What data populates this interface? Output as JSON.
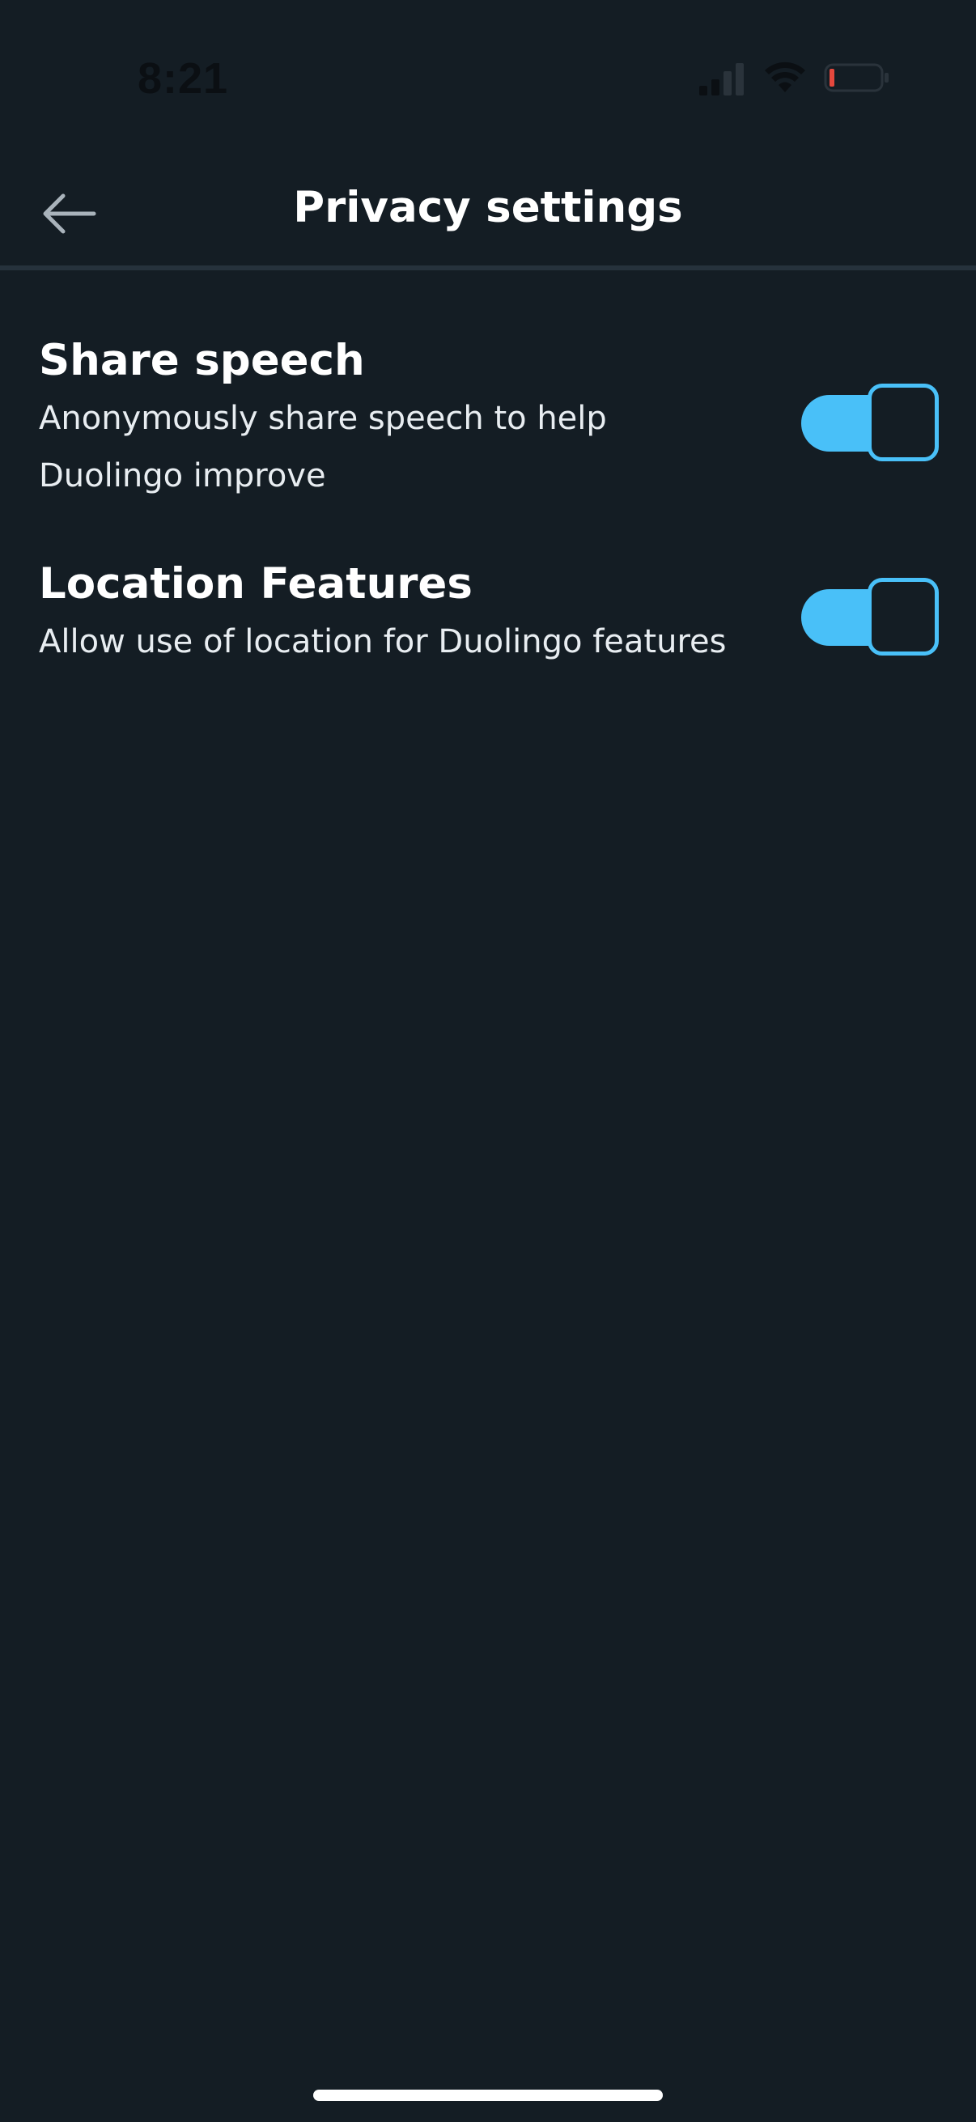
{
  "status_bar": {
    "time": "8:21",
    "battery_color": "#e5483d",
    "signal_icon": "cellular-signal-icon",
    "wifi_icon": "wifi-icon"
  },
  "header": {
    "title": "Privacy settings",
    "back_icon": "arrow-left-icon"
  },
  "settings": [
    {
      "title": "Share speech",
      "description": "Anonymously share speech to help Duolingo improve",
      "enabled": true
    },
    {
      "title": "Location Features",
      "description": "Allow use of location for Duolingo features",
      "enabled": true
    }
  ],
  "colors": {
    "background": "#141d24",
    "accent": "#49c0f8",
    "divider": "#26323c"
  }
}
